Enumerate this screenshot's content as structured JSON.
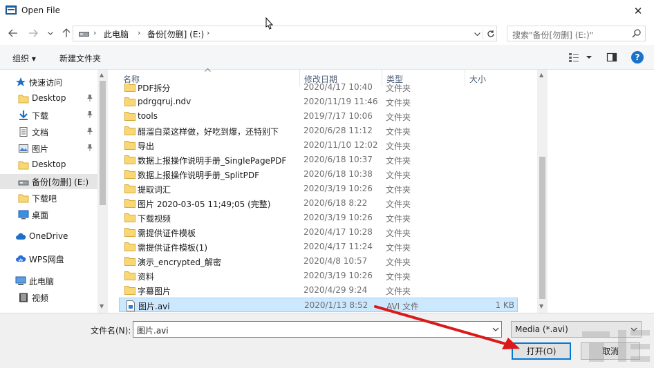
{
  "window": {
    "title": "Open File",
    "close_glyph": "✕"
  },
  "navigation": {
    "back_icon": "back-arrow-icon",
    "forward_icon": "forward-arrow-icon",
    "recent_icon": "chevron-down-icon",
    "up_icon": "up-arrow-icon"
  },
  "address": {
    "crumbs": [
      "此电脑",
      "备份[勿删] (E:)"
    ],
    "refresh_icon": "refresh-icon"
  },
  "search": {
    "placeholder": "搜索\"备份[勿删] (E:)\""
  },
  "toolbar": {
    "organize": "组织 ▾",
    "new_folder": "新建文件夹",
    "view_icon": "view-options-icon",
    "preview_icon": "preview-pane-icon",
    "help_icon": "help-icon",
    "help_label": "?"
  },
  "sidebar": {
    "items": [
      {
        "label": "快速访问",
        "icon": "star-icon"
      },
      {
        "label": "Desktop",
        "icon": "folder-icon",
        "pinned": true
      },
      {
        "label": "下载",
        "icon": "download-icon",
        "pinned": true
      },
      {
        "label": "文档",
        "icon": "document-icon",
        "pinned": true
      },
      {
        "label": "图片",
        "icon": "picture-icon",
        "pinned": true
      },
      {
        "label": "Desktop",
        "icon": "folder-icon"
      },
      {
        "label": "备份[勿删] (E:)",
        "icon": "drive-icon",
        "selected": true
      },
      {
        "label": "下载吧",
        "icon": "folder-icon"
      },
      {
        "label": "桌面",
        "icon": "desktop-icon"
      },
      {
        "label": "OneDrive",
        "icon": "cloud-icon"
      },
      {
        "label": "WPS网盘",
        "icon": "wps-cloud-icon"
      },
      {
        "label": "此电脑",
        "icon": "computer-icon"
      },
      {
        "label": "视频",
        "icon": "video-icon"
      }
    ]
  },
  "columns": {
    "name": "名称",
    "date": "修改日期",
    "type": "类型",
    "size": "大小"
  },
  "files": [
    {
      "name": "PDF拆分",
      "date": "2020/4/17 10:40",
      "type": "文件夹",
      "size": "",
      "kind": "folder"
    },
    {
      "name": "pdrgqruj.ndv",
      "date": "2020/11/19 11:46",
      "type": "文件夹",
      "size": "",
      "kind": "folder"
    },
    {
      "name": "tools",
      "date": "2019/7/17 10:06",
      "type": "文件夹",
      "size": "",
      "kind": "folder"
    },
    {
      "name": "醋溜白菜这样做，好吃到爆，还特别下",
      "date": "2020/6/28 11:12",
      "type": "文件夹",
      "size": "",
      "kind": "folder"
    },
    {
      "name": "导出",
      "date": "2020/11/10 12:02",
      "type": "文件夹",
      "size": "",
      "kind": "folder"
    },
    {
      "name": "数据上报操作说明手册_SinglePagePDF",
      "date": "2020/6/18 10:37",
      "type": "文件夹",
      "size": "",
      "kind": "folder"
    },
    {
      "name": "数据上报操作说明手册_SplitPDF",
      "date": "2020/6/18 10:38",
      "type": "文件夹",
      "size": "",
      "kind": "folder"
    },
    {
      "name": "提取词汇",
      "date": "2020/3/19 10:26",
      "type": "文件夹",
      "size": "",
      "kind": "folder"
    },
    {
      "name": "图片 2020-03-05 11;49;05 (完整)",
      "date": "2020/6/18 8:22",
      "type": "文件夹",
      "size": "",
      "kind": "folder"
    },
    {
      "name": "下载视频",
      "date": "2020/3/19 10:26",
      "type": "文件夹",
      "size": "",
      "kind": "folder"
    },
    {
      "name": "需提供证件模板",
      "date": "2020/4/17 10:28",
      "type": "文件夹",
      "size": "",
      "kind": "folder"
    },
    {
      "name": "需提供证件模板(1)",
      "date": "2020/4/17 11:24",
      "type": "文件夹",
      "size": "",
      "kind": "folder"
    },
    {
      "name": "演示_encrypted_解密",
      "date": "2020/4/8 10:57",
      "type": "文件夹",
      "size": "",
      "kind": "folder"
    },
    {
      "name": "资料",
      "date": "2020/3/19 10:26",
      "type": "文件夹",
      "size": "",
      "kind": "folder"
    },
    {
      "name": "字幕图片",
      "date": "2020/4/29 9:24",
      "type": "文件夹",
      "size": "",
      "kind": "folder"
    },
    {
      "name": "图片.avi",
      "date": "2020/1/13 8:52",
      "type": "AVI 文件",
      "size": "1 KB",
      "kind": "file",
      "selected": true
    }
  ],
  "bottom": {
    "filename_label": "文件名(N):",
    "filename_value": "图片.avi",
    "filter_value": "Media (*.avi)",
    "open_label": "打开(O)",
    "cancel_label": "取消"
  },
  "colors": {
    "selection_bg": "#cce8ff",
    "selection_border": "#99d1ff",
    "folder_yellow": "#f8d775",
    "accent_blue": "#0078d7",
    "annotation_red": "#d9191a"
  }
}
